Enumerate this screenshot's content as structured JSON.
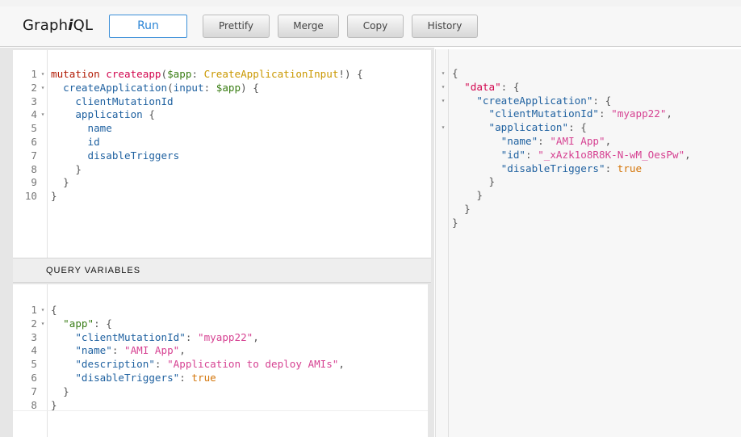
{
  "app": {
    "title_prefix": "Graph",
    "title_italic": "i",
    "title_suffix": "QL"
  },
  "toolbar": {
    "run": "Run",
    "prettify": "Prettify",
    "merge": "Merge",
    "copy": "Copy",
    "history": "History"
  },
  "query_editor": {
    "line_numbers": [
      "1",
      "2",
      "3",
      "4",
      "5",
      "6",
      "7",
      "8",
      "9",
      "10"
    ],
    "lines": [
      [
        {
          "t": "mutation ",
          "c": "kw"
        },
        {
          "t": "createapp",
          "c": "def"
        },
        {
          "t": "(",
          "c": "punct"
        },
        {
          "t": "$app",
          "c": "var"
        },
        {
          "t": ": ",
          "c": "punct"
        },
        {
          "t": "CreateApplicationInput",
          "c": "type"
        },
        {
          "t": "!) {",
          "c": "punct"
        }
      ],
      [
        {
          "t": "  createApplication",
          "c": "prop"
        },
        {
          "t": "(",
          "c": "punct"
        },
        {
          "t": "input",
          "c": "prop"
        },
        {
          "t": ": ",
          "c": "punct"
        },
        {
          "t": "$app",
          "c": "var"
        },
        {
          "t": ") {",
          "c": "punct"
        }
      ],
      [
        {
          "t": "    clientMutationId",
          "c": "prop"
        }
      ],
      [
        {
          "t": "    application",
          "c": "prop"
        },
        {
          "t": " {",
          "c": "punct"
        }
      ],
      [
        {
          "t": "      name",
          "c": "prop"
        }
      ],
      [
        {
          "t": "      id",
          "c": "prop"
        }
      ],
      [
        {
          "t": "      disableTriggers",
          "c": "prop"
        }
      ],
      [
        {
          "t": "    }",
          "c": "punct"
        }
      ],
      [
        {
          "t": "  }",
          "c": "punct"
        }
      ],
      [
        {
          "t": "}",
          "c": "punct"
        }
      ]
    ],
    "folds": [
      true,
      true,
      false,
      true,
      false,
      false,
      false,
      false,
      false,
      false
    ]
  },
  "query_variables": {
    "title": "QUERY VARIABLES",
    "line_numbers": [
      "1",
      "2",
      "3",
      "4",
      "5",
      "6",
      "7",
      "8"
    ],
    "lines": [
      [
        {
          "t": "{",
          "c": "punct"
        }
      ],
      [
        {
          "t": "  ",
          "c": "punct"
        },
        {
          "t": "\"app\"",
          "c": "keyg"
        },
        {
          "t": ": {",
          "c": "punct"
        }
      ],
      [
        {
          "t": "    ",
          "c": "punct"
        },
        {
          "t": "\"clientMutationId\"",
          "c": "key"
        },
        {
          "t": ": ",
          "c": "punct"
        },
        {
          "t": "\"myapp22\"",
          "c": "str"
        },
        {
          "t": ",",
          "c": "punct"
        }
      ],
      [
        {
          "t": "    ",
          "c": "punct"
        },
        {
          "t": "\"name\"",
          "c": "key"
        },
        {
          "t": ": ",
          "c": "punct"
        },
        {
          "t": "\"AMI App\"",
          "c": "str"
        },
        {
          "t": ",",
          "c": "punct"
        }
      ],
      [
        {
          "t": "    ",
          "c": "punct"
        },
        {
          "t": "\"description\"",
          "c": "key"
        },
        {
          "t": ": ",
          "c": "punct"
        },
        {
          "t": "\"Application to deploy AMIs\"",
          "c": "str"
        },
        {
          "t": ",",
          "c": "punct"
        }
      ],
      [
        {
          "t": "    ",
          "c": "punct"
        },
        {
          "t": "\"disableTriggers\"",
          "c": "key"
        },
        {
          "t": ": ",
          "c": "punct"
        },
        {
          "t": "true",
          "c": "bool"
        }
      ],
      [
        {
          "t": "  }",
          "c": "punct"
        }
      ],
      [
        {
          "t": "}",
          "c": "punct"
        }
      ]
    ],
    "folds": [
      true,
      true,
      false,
      false,
      false,
      false,
      false,
      false
    ]
  },
  "result": {
    "lines": [
      [
        {
          "t": "{",
          "c": "punct"
        }
      ],
      [
        {
          "t": "  ",
          "c": "punct"
        },
        {
          "t": "\"data\"",
          "c": "def"
        },
        {
          "t": ": {",
          "c": "punct"
        }
      ],
      [
        {
          "t": "    ",
          "c": "punct"
        },
        {
          "t": "\"createApplication\"",
          "c": "key"
        },
        {
          "t": ": {",
          "c": "punct"
        }
      ],
      [
        {
          "t": "      ",
          "c": "punct"
        },
        {
          "t": "\"clientMutationId\"",
          "c": "key"
        },
        {
          "t": ": ",
          "c": "punct"
        },
        {
          "t": "\"myapp22\"",
          "c": "str"
        },
        {
          "t": ",",
          "c": "punct"
        }
      ],
      [
        {
          "t": "      ",
          "c": "punct"
        },
        {
          "t": "\"application\"",
          "c": "key"
        },
        {
          "t": ": {",
          "c": "punct"
        }
      ],
      [
        {
          "t": "        ",
          "c": "punct"
        },
        {
          "t": "\"name\"",
          "c": "key"
        },
        {
          "t": ": ",
          "c": "punct"
        },
        {
          "t": "\"AMI App\"",
          "c": "str"
        },
        {
          "t": ",",
          "c": "punct"
        }
      ],
      [
        {
          "t": "        ",
          "c": "punct"
        },
        {
          "t": "\"id\"",
          "c": "key"
        },
        {
          "t": ": ",
          "c": "punct"
        },
        {
          "t": "\"_xAzk1o8R8K-N-wM_OesPw\"",
          "c": "str"
        },
        {
          "t": ",",
          "c": "punct"
        }
      ],
      [
        {
          "t": "        ",
          "c": "punct"
        },
        {
          "t": "\"disableTriggers\"",
          "c": "key"
        },
        {
          "t": ": ",
          "c": "punct"
        },
        {
          "t": "true",
          "c": "bool"
        }
      ],
      [
        {
          "t": "      }",
          "c": "punct"
        }
      ],
      [
        {
          "t": "    }",
          "c": "punct"
        }
      ],
      [
        {
          "t": "  }",
          "c": "punct"
        }
      ],
      [
        {
          "t": "}",
          "c": "punct"
        }
      ]
    ],
    "folds": [
      true,
      true,
      true,
      false,
      true,
      false,
      false,
      false,
      false,
      false,
      false,
      false
    ]
  },
  "colors": {
    "accent": "#2d86d6",
    "keyword": "#b11a04",
    "string": "#d64292",
    "property": "#1f61a0",
    "type": "#ca9800",
    "variable": "#397d13"
  }
}
